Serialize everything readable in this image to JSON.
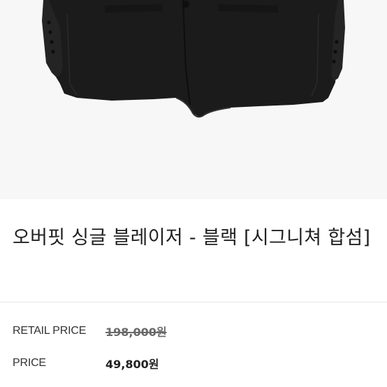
{
  "product": {
    "image_alt": "black oversized single blazer",
    "title": "오버핏 싱글 블레이저 - 블랙 [시그니쳐 합섬]",
    "retail_price_label": "RETAIL PRICE",
    "retail_price_value": "198,000원",
    "price_label": "PRICE",
    "price_value": "49,800원"
  },
  "colors": {
    "image_background": "#f7f7f7",
    "garment": "#1b1b1b",
    "text": "#222222",
    "muted": "#6a6a6a"
  }
}
